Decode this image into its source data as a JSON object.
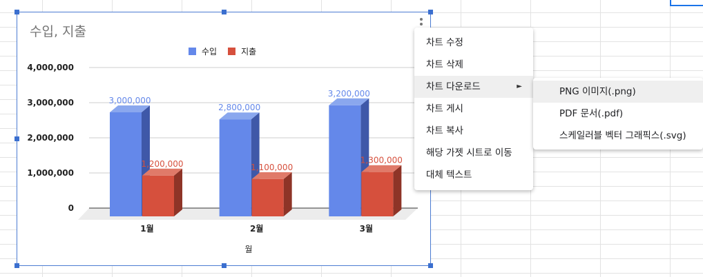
{
  "chart": {
    "title": "수입, 지출",
    "colors": {
      "income": "#6488ea",
      "expense": "#d6503d",
      "frame": "#4a7bd1"
    }
  },
  "chart_data": {
    "type": "bar",
    "title": "수입, 지출",
    "categories": [
      "1월",
      "2월",
      "3월"
    ],
    "series": [
      {
        "name": "수입",
        "values": [
          3000000,
          2800000,
          3200000
        ],
        "labels": [
          "3,000,000",
          "2,800,000",
          "3,200,000"
        ]
      },
      {
        "name": "지출",
        "values": [
          1200000,
          1100000,
          1300000
        ],
        "labels": [
          "1,200,000",
          "1,100,000",
          "1,300,000"
        ]
      }
    ],
    "xlabel": "월",
    "ylabel": "",
    "ylim": [
      0,
      4000000
    ],
    "yticks": [
      "0",
      "1,000,000",
      "2,000,000",
      "3,000,000",
      "4,000,000"
    ],
    "grid": true,
    "legend": "top",
    "style": "3d-column"
  },
  "menu": {
    "items": [
      {
        "label": "차트 수정"
      },
      {
        "label": "차트 삭제"
      },
      {
        "label": "차트 다운로드",
        "arrow": "►"
      },
      {
        "label": "차트 게시"
      },
      {
        "label": "차트 복사"
      },
      {
        "label": "해당 가젯 시트로 이동"
      },
      {
        "label": "대체 텍스트"
      }
    ]
  },
  "submenu": {
    "items": [
      {
        "label": "PNG 이미지(.png)"
      },
      {
        "label": "PDF 문서(.pdf)"
      },
      {
        "label": "스케일러블 벡터 그래픽스(.svg)"
      }
    ]
  },
  "icons": {
    "more": "more-vert-icon",
    "submenu": "triangle-right-icon"
  }
}
